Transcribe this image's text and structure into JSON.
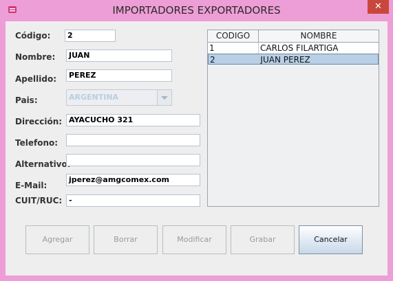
{
  "window": {
    "title": "IMPORTADORES EXPORTADORES",
    "close_glyph": "✕",
    "icon": "app-icon"
  },
  "form": {
    "codigo": {
      "label": "Código:",
      "value": "2"
    },
    "nombre": {
      "label": "Nombre:",
      "value": "JUAN"
    },
    "apellido": {
      "label": "Apellido:",
      "value": "PEREZ"
    },
    "pais": {
      "label": "Pais:",
      "value": "ARGENTINA"
    },
    "direccion": {
      "label": "Dirección:",
      "value": "AYACUCHO 321"
    },
    "telefono": {
      "label": "Telefono:",
      "value": ""
    },
    "alternativo": {
      "label": "Alternativo:",
      "value": ""
    },
    "email": {
      "label": "E-Mail:",
      "value": "jperez@amgcomex.com"
    },
    "cuit": {
      "label": "CUIT/RUC:",
      "value": "-"
    }
  },
  "table": {
    "headers": [
      "CODIGO",
      "NOMBRE"
    ],
    "rows": [
      {
        "codigo": "1",
        "nombre": "CARLOS  FILARTIGA"
      },
      {
        "codigo": "2",
        "nombre": "JUAN PEREZ"
      }
    ]
  },
  "buttons": {
    "agregar": "Agregar",
    "borrar": "Borrar",
    "modificar": "Modificar",
    "grabar": "Grabar",
    "cancelar": "Cancelar"
  },
  "colors": {
    "frame": "#ee9ed6",
    "close": "#c9463d",
    "selected_row": "#b8cfe5"
  }
}
